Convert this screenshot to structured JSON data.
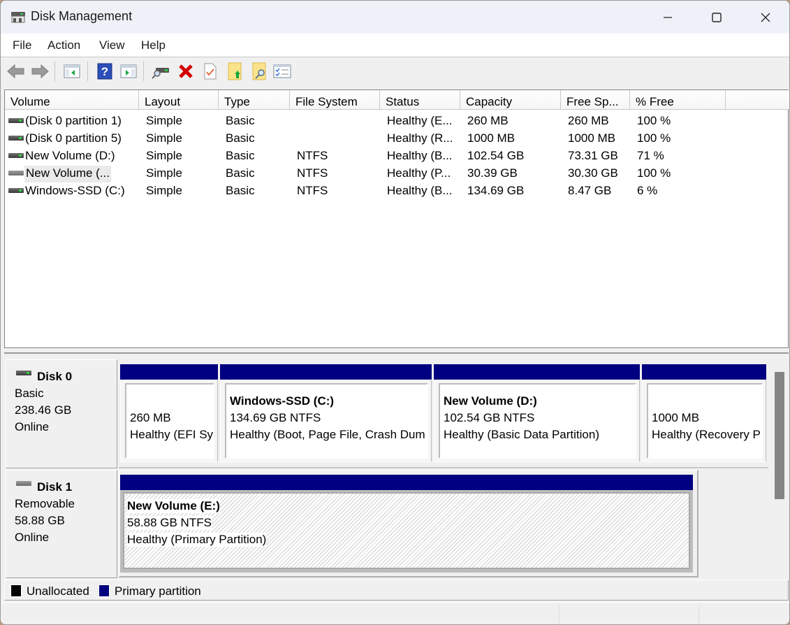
{
  "window": {
    "title": "Disk Management",
    "icon": "disk-management-icon",
    "controls": {
      "minimize": "minimize-icon",
      "maximize": "maximize-icon",
      "close": "close-icon"
    }
  },
  "menu": [
    {
      "label": "File"
    },
    {
      "label": "Action"
    },
    {
      "label": "View"
    },
    {
      "label": "Help"
    }
  ],
  "toolbar": [
    {
      "name": "back-button",
      "icon": "back-arrow-icon"
    },
    {
      "name": "forward-button",
      "icon": "forward-arrow-icon"
    },
    {
      "name": "show-hide-console-tree-button",
      "icon": "console-tree-icon"
    },
    {
      "name": "help-button",
      "icon": "help-icon"
    },
    {
      "name": "show-hide-action-pane-button",
      "icon": "action-pane-icon"
    },
    {
      "name": "connect-virtual-disk-button",
      "icon": "drive-magnify-icon"
    },
    {
      "name": "delete-button",
      "icon": "delete-x-icon"
    },
    {
      "name": "properties-button",
      "icon": "check-document-icon"
    },
    {
      "name": "open-button",
      "icon": "folder-up-icon"
    },
    {
      "name": "explore-button",
      "icon": "folder-search-icon"
    },
    {
      "name": "checklist-button",
      "icon": "checklist-icon"
    }
  ],
  "volume_list": {
    "columns": [
      "Volume",
      "Layout",
      "Type",
      "File System",
      "Status",
      "Capacity",
      "Free Sp...",
      "% Free"
    ],
    "rows": [
      {
        "volume": "(Disk 0 partition 1)",
        "layout": "Simple",
        "type": "Basic",
        "fs": "",
        "status": "Healthy (E...",
        "capacity": "260 MB",
        "free": "260 MB",
        "pct": "100 %",
        "icon": "drive-icon"
      },
      {
        "volume": "(Disk 0 partition 5)",
        "layout": "Simple",
        "type": "Basic",
        "fs": "",
        "status": "Healthy (R...",
        "capacity": "1000 MB",
        "free": "1000 MB",
        "pct": "100 %",
        "icon": "drive-icon"
      },
      {
        "volume": "New Volume (D:)",
        "layout": "Simple",
        "type": "Basic",
        "fs": "NTFS",
        "status": "Healthy (B...",
        "capacity": "102.54 GB",
        "free": "73.31 GB",
        "pct": "71 %",
        "icon": "drive-icon"
      },
      {
        "volume": "New Volume (...",
        "layout": "Simple",
        "type": "Basic",
        "fs": "NTFS",
        "status": "Healthy (P...",
        "capacity": "30.39 GB",
        "free": "30.30 GB",
        "pct": "100 %",
        "icon": "removable-drive-icon"
      },
      {
        "volume": "Windows-SSD (C:)",
        "layout": "Simple",
        "type": "Basic",
        "fs": "NTFS",
        "status": "Healthy (B...",
        "capacity": "134.69 GB",
        "free": "8.47 GB",
        "pct": "6 %",
        "icon": "drive-icon"
      }
    ]
  },
  "disks": [
    {
      "name": "Disk 0",
      "type": "Basic",
      "size": "238.46 GB",
      "state": "Online",
      "partitions": [
        {
          "title": "",
          "size": "260 MB",
          "status": "Healthy (EFI Sys"
        },
        {
          "title": "Windows-SSD  (C:)",
          "size": "134.69 GB NTFS",
          "status": "Healthy (Boot, Page File, Crash Dum"
        },
        {
          "title": "New Volume  (D:)",
          "size": "102.54 GB NTFS",
          "status": "Healthy (Basic Data Partition)"
        },
        {
          "title": "",
          "size": "1000 MB",
          "status": "Healthy (Recovery P"
        }
      ]
    },
    {
      "name": "Disk 1",
      "type": "Removable",
      "size": "58.88 GB",
      "state": "Online",
      "partitions": [
        {
          "title": "New Volume  (E:)",
          "size": "58.88 GB NTFS",
          "status": "Healthy (Primary Partition)",
          "selected": true
        }
      ]
    }
  ],
  "legend": [
    {
      "label": "Unallocated",
      "color": "#000000"
    },
    {
      "label": "Primary partition",
      "color": "#000080"
    }
  ],
  "colors": {
    "primary_partition": "#000080",
    "unallocated": "#000000"
  }
}
